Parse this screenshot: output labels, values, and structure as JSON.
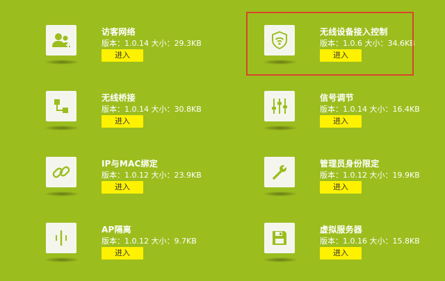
{
  "apps": [
    {
      "name": "访客网络",
      "meta": "版本：1.0.14  大小：29.3KB",
      "button": "进入",
      "icon": "users-icon"
    },
    {
      "name": "无线设备接入控制",
      "meta": "版本：1.0.6  大小：34.6KB",
      "button": "进入",
      "icon": "wifi-shield-icon"
    },
    {
      "name": "无线桥接",
      "meta": "版本：1.0.14  大小：30.8KB",
      "button": "进入",
      "icon": "bridge-icon"
    },
    {
      "name": "信号调节",
      "meta": "版本：1.0.14  大小：16.4KB",
      "button": "进入",
      "icon": "sliders-icon"
    },
    {
      "name": "IP与MAC绑定",
      "meta": "版本：1.0.12  大小：23.9KB",
      "button": "进入",
      "icon": "link-icon"
    },
    {
      "name": "管理员身份限定",
      "meta": "版本：1.0.12  大小：19.9KB",
      "button": "进入",
      "icon": "wrench-icon"
    },
    {
      "name": "AP隔离",
      "meta": "版本：1.0.12  大小：9.7KB",
      "button": "进入",
      "icon": "ap-isolation-icon"
    },
    {
      "name": "虚拟服务器",
      "meta": "版本：1.0.16  大小：15.8KB",
      "button": "进入",
      "icon": "save-icon"
    }
  ],
  "colors": {
    "background": "#9cbd1e",
    "button": "#fff200",
    "highlight_border": "#d8452a",
    "icon_tile": "#f4f6ee",
    "icon_glyph": "#9cbd1e"
  }
}
